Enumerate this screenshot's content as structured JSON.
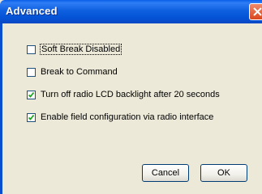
{
  "window": {
    "title": "Advanced"
  },
  "options": [
    {
      "label": "Soft Break Disabled",
      "checked": false
    },
    {
      "label": "Break to Command",
      "checked": false
    },
    {
      "label": "Turn off radio LCD backlight after 20 seconds",
      "checked": true
    },
    {
      "label": "Enable field configuration via radio interface",
      "checked": true
    }
  ],
  "buttons": {
    "cancel": "Cancel",
    "ok": "OK"
  }
}
